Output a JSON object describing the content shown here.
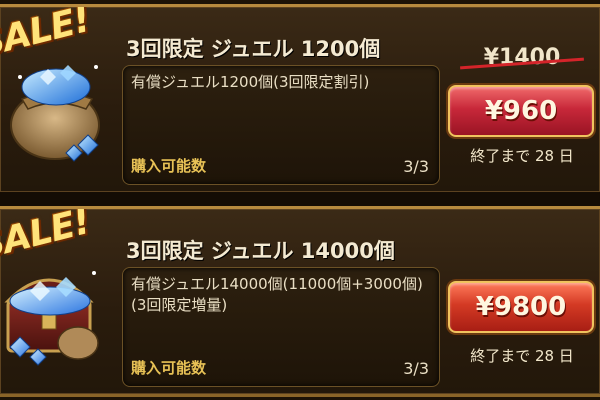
{
  "offers": [
    {
      "badge": "SALE!",
      "art_icon": "jewel-bag-icon",
      "title": "3回限定 ジュエル 1200個",
      "description": "有償ジュエル1200個(3回限定割引)",
      "limit_label": "購入可能数",
      "limit_value": "3/3",
      "original_price": "¥1400",
      "price": "¥960",
      "remaining": "終了まで 28 日"
    },
    {
      "badge": "SALE!",
      "art_icon": "jewel-chest-icon",
      "title": "3回限定 ジュエル 14000個",
      "description": "有償ジュエル14000個(11000個+3000個)(3回限定増量)",
      "limit_label": "購入可能数",
      "limit_value": "3/3",
      "price": "¥9800",
      "remaining": "終了まで 28 日"
    }
  ],
  "colors": {
    "accent_gold": "#e8c256",
    "strike_red": "#d4242a",
    "button_red": "#c8283a",
    "button_orange": "#d43a24"
  }
}
